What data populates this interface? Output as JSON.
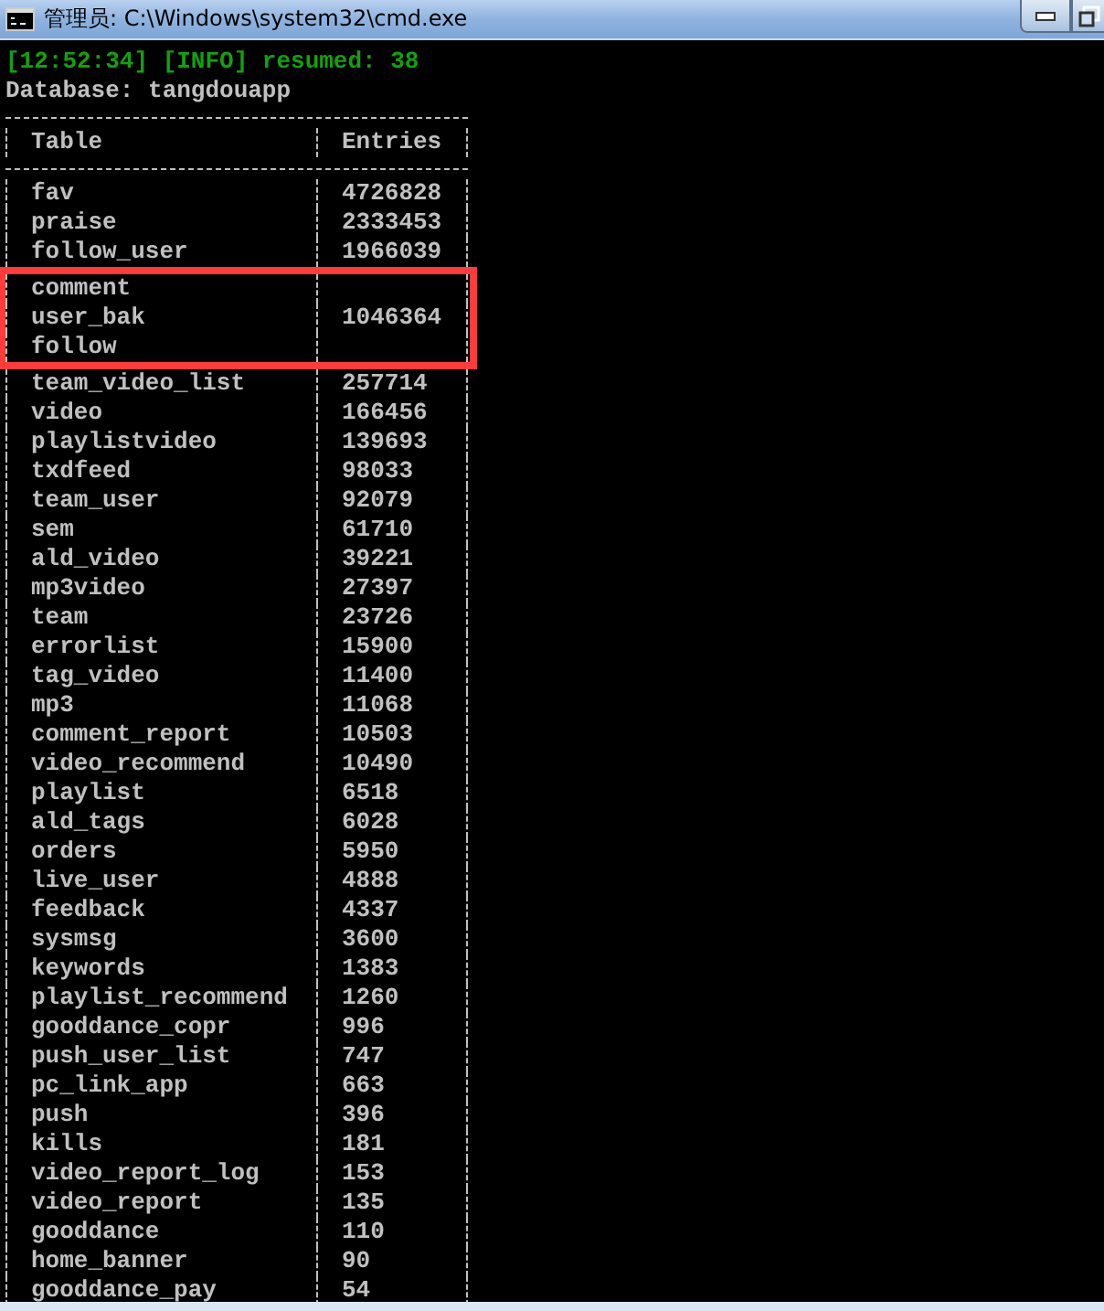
{
  "window": {
    "title": "管理员: C:\\Windows\\system32\\cmd.exe"
  },
  "console": {
    "lines": [
      {
        "kind": "info",
        "text": "[12:52:34] [INFO] resumed: 38"
      },
      {
        "kind": "plain",
        "text": "Database: tangdouapp"
      }
    ]
  },
  "table": {
    "columns": [
      "Table",
      "Entries"
    ],
    "rows": [
      {
        "table": "fav",
        "entries": "4726828",
        "highlighted": false
      },
      {
        "table": "praise",
        "entries": "2333453",
        "highlighted": false
      },
      {
        "table": "follow_user",
        "entries": "1966039",
        "highlighted": false
      },
      {
        "table": "comment",
        "highlighted": true
      },
      {
        "table": "user_bak",
        "entries": "1046364",
        "highlighted": true
      },
      {
        "table": "follow",
        "highlighted": true
      },
      {
        "table": "team_video_list",
        "entries": "257714",
        "highlighted": false
      },
      {
        "table": "video",
        "entries": "166456",
        "highlighted": false
      },
      {
        "table": "playlistvideo",
        "entries": "139693",
        "highlighted": false
      },
      {
        "table": "txdfeed",
        "entries": "98033",
        "highlighted": false
      },
      {
        "table": "team_user",
        "entries": "92079",
        "highlighted": false
      },
      {
        "table": "sem",
        "entries": "61710",
        "highlighted": false
      },
      {
        "table": "ald_video",
        "entries": "39221",
        "highlighted": false
      },
      {
        "table": "mp3video",
        "entries": "27397",
        "highlighted": false
      },
      {
        "table": "team",
        "entries": "23726",
        "highlighted": false
      },
      {
        "table": "errorlist",
        "entries": "15900",
        "highlighted": false
      },
      {
        "table": "tag_video",
        "entries": "11400",
        "highlighted": false
      },
      {
        "table": "mp3",
        "entries": "11068",
        "highlighted": false
      },
      {
        "table": "comment_report",
        "entries": "10503",
        "highlighted": false
      },
      {
        "table": "video_recommend",
        "entries": "10490",
        "highlighted": false
      },
      {
        "table": "playlist",
        "entries": "6518",
        "highlighted": false
      },
      {
        "table": "ald_tags",
        "entries": "6028",
        "highlighted": false
      },
      {
        "table": "orders",
        "entries": "5950",
        "highlighted": false
      },
      {
        "table": "live_user",
        "entries": "4888",
        "highlighted": false
      },
      {
        "table": "feedback",
        "entries": "4337",
        "highlighted": false
      },
      {
        "table": "sysmsg",
        "entries": "3600",
        "highlighted": false
      },
      {
        "table": "keywords",
        "entries": "1383",
        "highlighted": false
      },
      {
        "table": "playlist_recommend",
        "entries": "1260",
        "highlighted": false
      },
      {
        "table": "gooddance_copr",
        "entries": "996",
        "highlighted": false
      },
      {
        "table": "push_user_list",
        "entries": "747",
        "highlighted": false
      },
      {
        "table": "pc_link_app",
        "entries": "663",
        "highlighted": false
      },
      {
        "table": "push",
        "entries": "396",
        "highlighted": false
      },
      {
        "table": "kills",
        "entries": "181",
        "highlighted": false
      },
      {
        "table": "video_report_log",
        "entries": "153",
        "highlighted": false
      },
      {
        "table": "video_report",
        "entries": "135",
        "highlighted": false
      },
      {
        "table": "gooddance",
        "entries": "110",
        "highlighted": false
      },
      {
        "table": "home_banner",
        "entries": "90",
        "highlighted": false
      },
      {
        "table": "gooddance_pay",
        "entries": "54",
        "highlighted": false
      }
    ]
  }
}
